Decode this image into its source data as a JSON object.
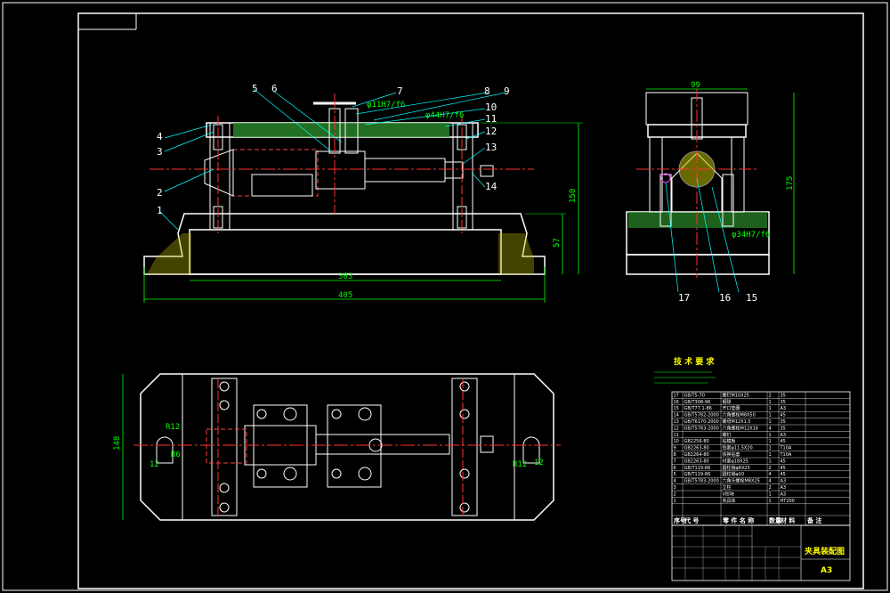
{
  "drawing": {
    "title_block_name": "夹具装配图",
    "sheet_size": "A3",
    "tech_req_title": "技 术 要 求",
    "front_view": {
      "callouts": [
        "1",
        "2",
        "3",
        "4",
        "5",
        "6",
        "7",
        "8",
        "9",
        "10",
        "11",
        "12",
        "13",
        "14"
      ],
      "dims": {
        "length_inner": "303",
        "length_total": "405",
        "height_a": "150",
        "height_b": "57"
      },
      "fits": [
        "φ11H7/f6",
        "φ44H7/f6"
      ]
    },
    "side_view": {
      "callouts": [
        "15",
        "16",
        "17"
      ],
      "dims": {
        "width": "99",
        "height": "175"
      },
      "fits": [
        "φ34H7/f6"
      ]
    },
    "top_view": {
      "dims": {
        "width": "148",
        "r_left": "R12",
        "r_left_small": "R6",
        "w_left": "12",
        "r_right": "R12",
        "w_right": "12"
      }
    },
    "bom_header": [
      "序号",
      "代  号",
      "零 件 名 称",
      "数量",
      "材  料",
      "备  注"
    ],
    "bom_rows": [
      [
        "17",
        "GB/T5-70",
        "螺钉M10X25",
        "2",
        "35",
        ""
      ],
      [
        "16",
        "GB/T308-96",
        "钢球",
        "1",
        "35",
        ""
      ],
      [
        "15",
        "GB/T77.1-86",
        "开口垫圈",
        "1",
        "A3",
        ""
      ],
      [
        "14",
        "GB/T5782-2000",
        "六角螺栓M8X50",
        "1",
        "45",
        ""
      ],
      [
        "13",
        "GB/T6170-2000",
        "螺母M12X1.5",
        "1",
        "35",
        ""
      ],
      [
        "12",
        "GB/T5783-2000",
        "六角螺栓M12X16",
        "4",
        "35",
        ""
      ],
      [
        "11",
        "",
        "螺钉",
        "1",
        "A3",
        ""
      ],
      [
        "10",
        "GB2256-80",
        "钻模板",
        "1",
        "45",
        ""
      ],
      [
        "9",
        "GB2263-80",
        "钻套φ11.5X20",
        "1",
        "T10A",
        ""
      ],
      [
        "8",
        "GB2264-80",
        "快换钻套",
        "1",
        "T10A",
        ""
      ],
      [
        "7",
        "GB2263-80",
        "衬套φ18X25",
        "1",
        "45",
        ""
      ],
      [
        "6",
        "GB/T119-86",
        "圆柱销φ8X25",
        "2",
        "45",
        ""
      ],
      [
        "5",
        "GB/T119-86",
        "圆柱销φ10",
        "4",
        "45",
        ""
      ],
      [
        "4",
        "GB/T5783-2000",
        "六角头螺栓M8X25",
        "4",
        "A3",
        ""
      ],
      [
        "3",
        "",
        "立柱",
        "2",
        "A3",
        ""
      ],
      [
        "2",
        "",
        "V形块",
        "1",
        "A3",
        ""
      ],
      [
        "1",
        "",
        "夹具体",
        "1",
        "HT200",
        ""
      ]
    ]
  }
}
